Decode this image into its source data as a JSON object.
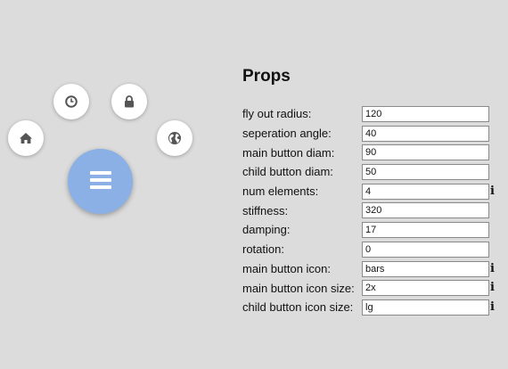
{
  "menu": {
    "main_icon": "bars-icon",
    "main_color": "#8ab0e6",
    "children": [
      {
        "icon": "home-icon"
      },
      {
        "icon": "clock-icon"
      },
      {
        "icon": "lock-icon"
      },
      {
        "icon": "globe-icon"
      }
    ]
  },
  "props": {
    "title": "Props",
    "fields": [
      {
        "label": "fly out radius:",
        "value": "120",
        "info": ""
      },
      {
        "label": "seperation angle:",
        "value": "40",
        "info": ""
      },
      {
        "label": "main button diam:",
        "value": "90",
        "info": ""
      },
      {
        "label": "child button diam:",
        "value": "50",
        "info": ""
      },
      {
        "label": "num elements:",
        "value": "4",
        "info": "i"
      },
      {
        "label": "stiffness:",
        "value": "320",
        "info": ""
      },
      {
        "label": "damping:",
        "value": "17",
        "info": ""
      },
      {
        "label": "rotation:",
        "value": "0",
        "info": ""
      },
      {
        "label": "main button icon:",
        "value": "bars",
        "info": "i"
      },
      {
        "label": "main button icon size:",
        "value": "2x",
        "info": "i"
      },
      {
        "label": "child button icon size:",
        "value": "lg",
        "info": "i"
      }
    ]
  }
}
